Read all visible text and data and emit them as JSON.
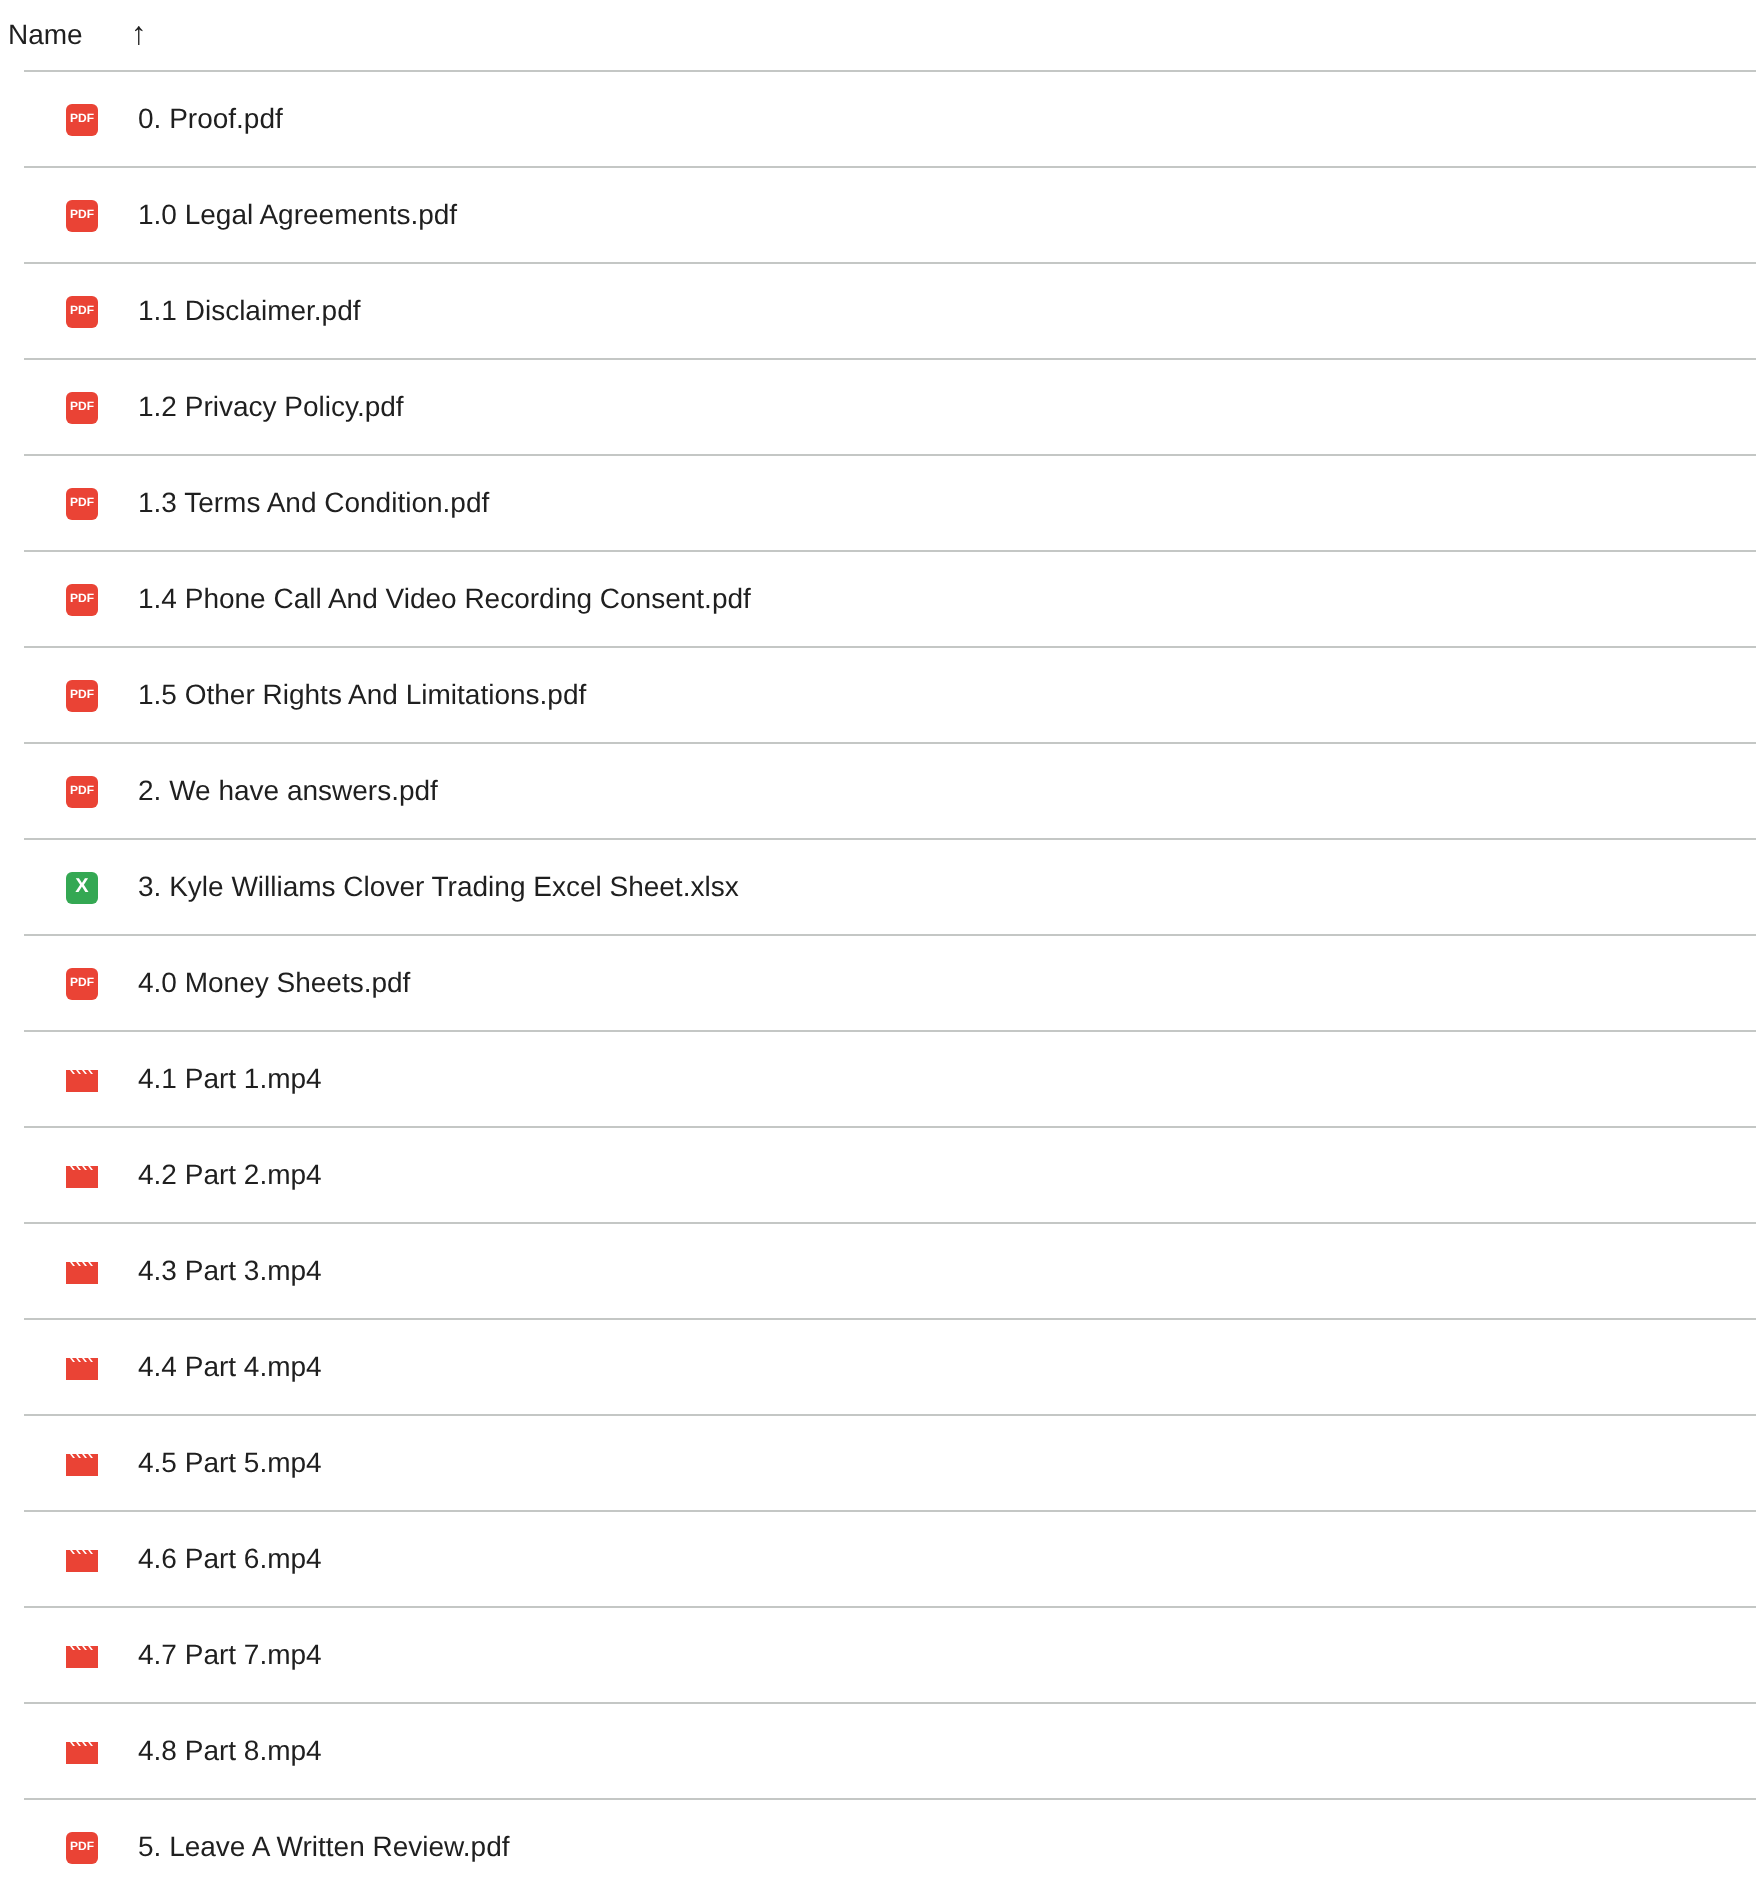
{
  "header": {
    "label": "Name",
    "sort_icon": "↑"
  },
  "files": [
    {
      "kind": "pdf",
      "badge": "PDF",
      "name": "0. Proof.pdf"
    },
    {
      "kind": "pdf",
      "badge": "PDF",
      "name": "1.0 Legal Agreements.pdf"
    },
    {
      "kind": "pdf",
      "badge": "PDF",
      "name": "1.1 Disclaimer.pdf"
    },
    {
      "kind": "pdf",
      "badge": "PDF",
      "name": "1.2 Privacy Policy.pdf"
    },
    {
      "kind": "pdf",
      "badge": "PDF",
      "name": "1.3 Terms And Condition.pdf"
    },
    {
      "kind": "pdf",
      "badge": "PDF",
      "name": "1.4 Phone Call And Video Recording Consent.pdf"
    },
    {
      "kind": "pdf",
      "badge": "PDF",
      "name": "1.5 Other Rights And Limitations.pdf"
    },
    {
      "kind": "pdf",
      "badge": "PDF",
      "name": "2. We have answers.pdf"
    },
    {
      "kind": "sheet",
      "badge": "X",
      "name": "3. Kyle Williams Clover Trading Excel Sheet.xlsx"
    },
    {
      "kind": "pdf",
      "badge": "PDF",
      "name": "4.0 Money Sheets.pdf"
    },
    {
      "kind": "video",
      "name": "4.1 Part 1.mp4"
    },
    {
      "kind": "video",
      "name": "4.2 Part 2.mp4"
    },
    {
      "kind": "video",
      "name": "4.3 Part 3.mp4"
    },
    {
      "kind": "video",
      "name": "4.4 Part 4.mp4"
    },
    {
      "kind": "video",
      "name": "4.5 Part 5.mp4"
    },
    {
      "kind": "video",
      "name": "4.6 Part 6.mp4"
    },
    {
      "kind": "video",
      "name": "4.7 Part 7.mp4"
    },
    {
      "kind": "video",
      "name": "4.8 Part 8.mp4"
    },
    {
      "kind": "pdf",
      "badge": "PDF",
      "name": "5. Leave A Written Review.pdf"
    }
  ]
}
